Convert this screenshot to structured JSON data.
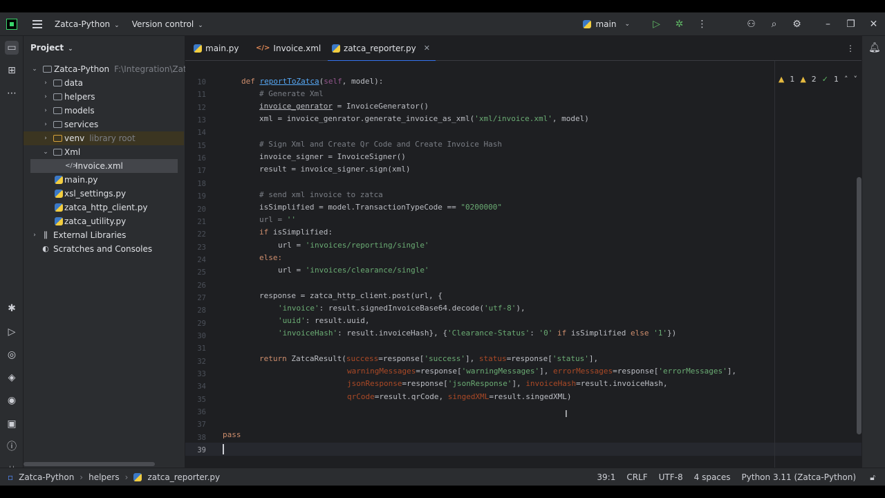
{
  "titlebar": {
    "project": "Zatca-Python",
    "version_control": "Version control",
    "branch": "main"
  },
  "project_panel": {
    "title": "Project",
    "items": [
      {
        "label": "Zatca-Python",
        "hint": "F:\\Integration\\Zatca-"
      },
      {
        "label": "data"
      },
      {
        "label": "helpers"
      },
      {
        "label": "models"
      },
      {
        "label": "services"
      },
      {
        "label": "venv",
        "hint": "library root"
      },
      {
        "label": "Xml"
      },
      {
        "label": "Invoice.xml"
      },
      {
        "label": "main.py"
      },
      {
        "label": "xsl_settings.py"
      },
      {
        "label": "zatca_http_client.py"
      },
      {
        "label": "zatca_utility.py"
      },
      {
        "label": "External Libraries"
      },
      {
        "label": "Scratches and Consoles"
      }
    ]
  },
  "tabs": [
    {
      "label": "main.py"
    },
    {
      "label": "Invoice.xml"
    },
    {
      "label": "zatca_reporter.py",
      "active": true
    }
  ],
  "inspections": {
    "warnings_a": "1",
    "warnings_b": "2",
    "ok": "1"
  },
  "editor": {
    "line_numbers": [
      "10",
      "11",
      "12",
      "13",
      "14",
      "15",
      "16",
      "17",
      "18",
      "19",
      "20",
      "21",
      "22",
      "23",
      "24",
      "25",
      "26",
      "27",
      "28",
      "29",
      "30",
      "31",
      "32",
      "33",
      "34",
      "35",
      "36",
      "37",
      "38",
      "39"
    ]
  },
  "code": {
    "l10_kw": "def ",
    "l10_fn": "reportToZatca",
    "l10_p1": "(",
    "l10_self": "self",
    "l10_p2": ", model):",
    "l11": "# Generate Xml",
    "l12_a": "invoice_genrator",
    "l12_b": " = InvoiceGenerator()",
    "l13_a": "xml = invoice_genrator.generate_invoice_as_xml(",
    "l13_s": "'xml/invoice.xml'",
    "l13_b": ", model)",
    "l15": "# Sign Xml and Create Qr Code and Create Invoice Hash",
    "l16": "invoice_signer = InvoiceSigner()",
    "l17": "result = invoice_signer.sign(xml)",
    "l19": "# send xml invoice to zatca",
    "l20_a": "isSimplified = model.TransactionTypeCode == ",
    "l20_s": "\"0200000\"",
    "l21_a": "url",
    "l21_b": " = ",
    "l21_s": "''",
    "l22_kw": "if ",
    "l22_b": "isSimplified:",
    "l23_a": "url = ",
    "l23_s": "'invoices/reporting/single'",
    "l24_kw": "else:",
    "l25_a": "url = ",
    "l25_s": "'invoices/clearance/single'",
    "l27": "response = zatca_http_client.post(url, {",
    "l28_s": "'invoice'",
    "l28_b": ": result.signedInvoiceBase64.decode(",
    "l28_s2": "'utf-8'",
    "l28_c": "),",
    "l29_s": "'uuid'",
    "l29_b": ": result.uuid,",
    "l30_s": "'invoiceHash'",
    "l30_b": ": result.invoiceHash}, {",
    "l30_s2": "'Clearance-Status'",
    "l30_c": ": ",
    "l30_s3": "'0'",
    "l30_kw": " if ",
    "l30_d": "isSimplified ",
    "l30_kw2": "else ",
    "l30_s4": "'1'",
    "l30_e": "})",
    "l32_kw": "return ",
    "l32_a": "ZatcaResult(",
    "l32_p1": "success",
    "l32_b": "=response[",
    "l32_s1": "'success'",
    "l32_c": "], ",
    "l32_p2": "status",
    "l32_d": "=response[",
    "l32_s2": "'status'",
    "l32_e": "],",
    "l33_p1": "warningMessages",
    "l33_a": "=response[",
    "l33_s1": "'warningMessages'",
    "l33_b": "], ",
    "l33_p2": "errorMessages",
    "l33_c": "=response[",
    "l33_s2": "'errorMessages'",
    "l33_d": "],",
    "l34_p1": "jsonResponse",
    "l34_a": "=response[",
    "l34_s1": "'jsonResponse'",
    "l34_b": "], ",
    "l34_p2": "invoiceHash",
    "l34_c": "=result.invoiceHash,",
    "l35_p1": "qrCode",
    "l35_a": "=result.qrCode, ",
    "l35_p2": "singedXML",
    "l35_b": "=result.singedXML)",
    "l38": "pass"
  },
  "statusbar": {
    "crumb1": "Zatca-Python",
    "crumb2": "helpers",
    "crumb3": "zatca_reporter.py",
    "position": "39:1",
    "line_sep": "CRLF",
    "encoding": "UTF-8",
    "indent": "4 spaces",
    "interpreter": "Python 3.11 (Zatca-Python)"
  }
}
